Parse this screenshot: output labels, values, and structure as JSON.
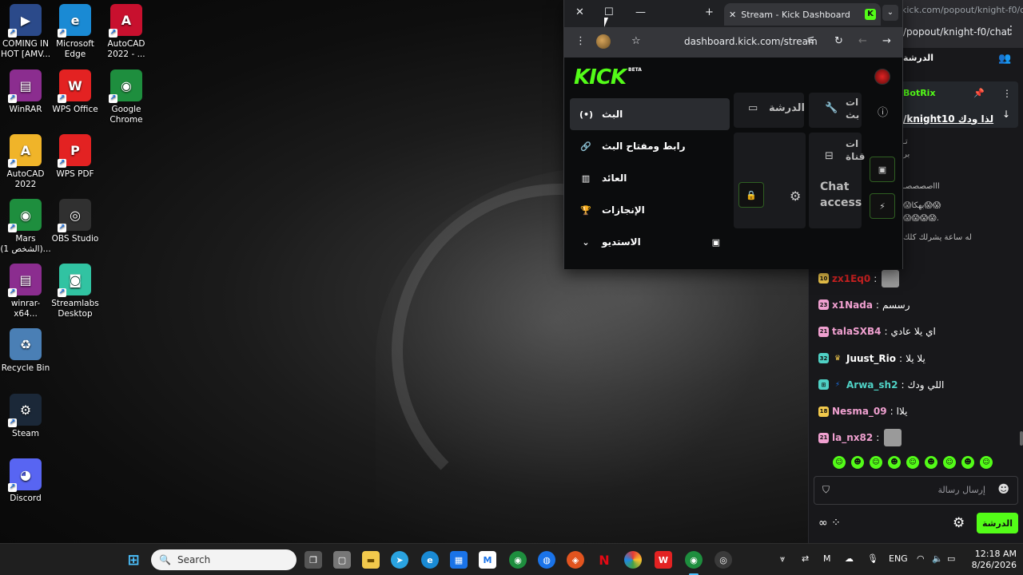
{
  "desktop": {
    "icons": [
      {
        "label": "COMING IN HOT [AMV...",
        "color": "#2b4a8a",
        "glyph": "▶"
      },
      {
        "label": "Microsoft Edge",
        "color": "#1a8ad4",
        "glyph": "e"
      },
      {
        "label": "AutoCAD 2022 - ...",
        "color": "#c8102e",
        "glyph": "A"
      },
      {
        "label": "WinRAR",
        "color": "#8b2d8f",
        "glyph": "▤"
      },
      {
        "label": "WPS Office",
        "color": "#e32222",
        "glyph": "W"
      },
      {
        "label": "Google Chrome",
        "color": "#1e8e3e",
        "glyph": "◉"
      },
      {
        "label": "AutoCAD 2022",
        "color": "#f0b429",
        "glyph": "A"
      },
      {
        "label": "WPS PDF",
        "color": "#e32222",
        "glyph": "P"
      },
      {
        "label": "Mars (الشخص 1)...",
        "color": "#1e8e3e",
        "glyph": "◉"
      },
      {
        "label": "OBS Studio",
        "color": "#303030",
        "glyph": "◎"
      },
      {
        "label": "winrar-x64...",
        "color": "#8b2d8f",
        "glyph": "▤"
      },
      {
        "label": "Streamlabs Desktop",
        "color": "#31c3a2",
        "glyph": "◙"
      },
      {
        "label": "Recycle Bin",
        "color": "#4a7fb5",
        "glyph": "♻"
      },
      {
        "label": "Steam",
        "color": "#1b2838",
        "glyph": "⚙"
      },
      {
        "label": "Discord",
        "color": "#5865f2",
        "glyph": "◕"
      }
    ]
  },
  "browser": {
    "tab_title": "Stream - Kick Dashboard",
    "tab_favicon": "K",
    "url": "dashboard.kick.com/stream",
    "logo": "KICK",
    "logo_badge": "BETA",
    "menu": [
      {
        "label": "البث",
        "icon": "(•)",
        "active": true
      },
      {
        "label": "رابط ومفتاح البث",
        "icon": "🔗",
        "active": false
      },
      {
        "label": "العائد",
        "icon": "▥",
        "active": false
      },
      {
        "label": "الإنجازات",
        "icon": "🏆",
        "active": false
      },
      {
        "label": "الاستديو",
        "icon": "⌄",
        "trail": "▣",
        "active": false
      }
    ],
    "widgets": {
      "chat_tab": "الدرشة",
      "cut_title_1": "ات\nبث",
      "cut_title_2": "ات\nقناة",
      "chat_access": "Chat\naccess"
    }
  },
  "chat_window": {
    "url_short": "kick.com/popout/knight-f0/c...",
    "url_path": "/popout/knight-f0/chat",
    "title": "الدرشة",
    "pinned": {
      "name": "BotRix",
      "message": "/knight10 لذا ودك"
    },
    "partial_lines": [
      "تـ",
      "بر",
      "اااصصصصـ",
      "😱بهكا😱😱",
      "😱😱😱😱.",
      "له ساعة يشرلك كلك"
    ],
    "messages": [
      {
        "badge": "10",
        "badge_color": "#f2c94c",
        "user": "zx1Eq0",
        "user_color": "#e02424",
        "text": "",
        "emote": true
      },
      {
        "badge": "23",
        "badge_color": "#f0a0d0",
        "user": "x1Nada",
        "user_color": "#f0a0d0",
        "text": "رسسم"
      },
      {
        "badge": "21",
        "badge_color": "#f0a0d0",
        "user": "talaSXB4",
        "user_color": "#f0a0d0",
        "text": "اي يلا عادي"
      },
      {
        "badge": "32",
        "badge_color": "#4fd1c5",
        "badge2": "♛",
        "badge2_color": "#f2c94c",
        "user": "Juust_Rio",
        "user_color": "#ffffff",
        "text": "يلا يلا"
      },
      {
        "badge": "⊞",
        "badge_color": "#4fd1c5",
        "badge2": "⚡",
        "badge2_color": "#1a73e8",
        "user": "Arwa_sh2",
        "user_color": "#4fd1c5",
        "text": "اللي ودك"
      },
      {
        "badge": "18",
        "badge_color": "#f2c94c",
        "user": "Nesma_09",
        "user_color": "#f0a0d0",
        "text": "يلاا"
      },
      {
        "badge": "21",
        "badge_color": "#f0a0d0",
        "user": "la_nx82",
        "user_color": "#f0a0d0",
        "text": "",
        "emote": true
      }
    ],
    "input_placeholder": "إرسال رسالة",
    "send_label": "الدرشة"
  },
  "taskbar": {
    "search_placeholder": "Search",
    "language": "ENG",
    "time": "12:18 AM",
    "date": "8/26/2026"
  }
}
